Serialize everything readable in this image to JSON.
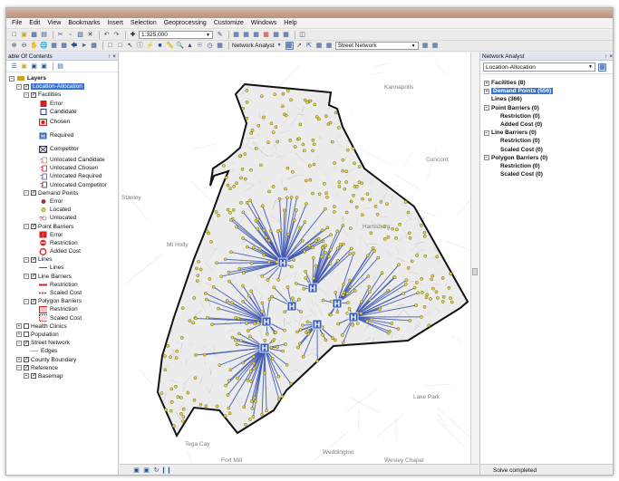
{
  "menu": [
    "File",
    "Edit",
    "View",
    "Bookmarks",
    "Insert",
    "Selection",
    "Geoprocessing",
    "Customize",
    "Windows",
    "Help"
  ],
  "toolbar": {
    "scale": "1:325,000",
    "network_analyst_label": "Network Analyst",
    "network_dataset": "Street Network"
  },
  "toc": {
    "title": "able Of Contents",
    "pin": "↑ ×",
    "root": "Layers",
    "group": "Location-Allocation",
    "facilities": "Facilities",
    "fac_items": [
      "Error",
      "Candidate",
      "Chosen",
      "Required",
      "Competitor",
      "Unlocated Candidate",
      "Unlocated Chosen",
      "Unlocated Required",
      "Unlocated Competitor"
    ],
    "demand": "Demand Points",
    "demand_items": [
      "Error",
      "Located",
      "Unlocated"
    ],
    "point_barriers": "Point Barriers",
    "pb_items": [
      "Error",
      "Restriction",
      "Added Cost"
    ],
    "lines": "Lines",
    "lines_items": [
      "Lines"
    ],
    "line_barriers": "Line Barriers",
    "lb_items": [
      "Restriction",
      "Scaled Cost"
    ],
    "polygon_barriers": "Polygon Barriers",
    "pgb_items": [
      "Restriction",
      "Scaled Cost"
    ],
    "other_layers": [
      "Health Clinics",
      "Population",
      "Street Network"
    ],
    "edges": "Edges",
    "county": "County Boundary",
    "reference": "Reference",
    "basemap": "Basemap"
  },
  "map": {
    "labels": [
      "Kannapolis",
      "Concord",
      "Stanley",
      "Mt Holly",
      "Harrisburg",
      "Lake Park",
      "Tega Cay",
      "Fort Mill",
      "Weddington",
      "Wesley Chapel"
    ]
  },
  "na": {
    "title": "Network Analyst",
    "pin": "↑ ×",
    "layer": "Location-Allocation",
    "items": [
      {
        "label": "Facilities (8)",
        "sub": false,
        "sel": false,
        "exp": "+"
      },
      {
        "label": "Demand Points (556)",
        "sub": false,
        "sel": true,
        "exp": "+"
      },
      {
        "label": "Lines (366)",
        "sub": false,
        "sel": false,
        "exp": ""
      },
      {
        "label": "Point Barriers (0)",
        "sub": false,
        "sel": false,
        "exp": "−"
      },
      {
        "label": "Restriction (0)",
        "sub": true,
        "sel": false,
        "exp": ""
      },
      {
        "label": "Added Cost (0)",
        "sub": true,
        "sel": false,
        "exp": ""
      },
      {
        "label": "Line Barriers (0)",
        "sub": false,
        "sel": false,
        "exp": "−"
      },
      {
        "label": "Restriction (0)",
        "sub": true,
        "sel": false,
        "exp": ""
      },
      {
        "label": "Scaled Cost (0)",
        "sub": true,
        "sel": false,
        "exp": ""
      },
      {
        "label": "Polygon Barriers (0)",
        "sub": false,
        "sel": false,
        "exp": "−"
      },
      {
        "label": "Restriction (0)",
        "sub": true,
        "sel": false,
        "exp": ""
      },
      {
        "label": "Scaled Cost (0)",
        "sub": true,
        "sel": false,
        "exp": ""
      }
    ],
    "status": "Solve completed"
  },
  "colors": {
    "spider": "#3d55b0",
    "facility": "#3a5fb8",
    "demand": "#e6d33a",
    "error": "#d02020"
  }
}
